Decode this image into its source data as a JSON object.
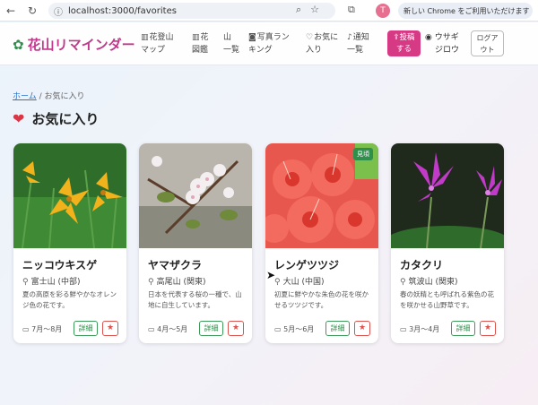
{
  "browser": {
    "url": "localhost:3000/favorites",
    "profile_initial": "T",
    "update_text": "新しい Chrome をご利用いただけます"
  },
  "header": {
    "logo": "花山リマインダー",
    "nav": [
      {
        "icon": "map-icon",
        "label1": "花登山",
        "label2": "マップ"
      },
      {
        "icon": "book-icon",
        "label1": "花",
        "label2": "図鑑"
      },
      {
        "icon": "",
        "label1": "山",
        "label2": "一覧"
      },
      {
        "icon": "camera-icon",
        "label1": "写真ラン",
        "label2": "キング"
      },
      {
        "icon": "heart-outline-icon",
        "label1": "お気に",
        "label2": "入り"
      },
      {
        "icon": "bell-icon",
        "label1": "通知",
        "label2": "一覧"
      }
    ],
    "post_label1": "投稿",
    "post_label2": "する",
    "user_label1": "ウサギ",
    "user_label2": "ジロウ",
    "logout_label1": "ログア",
    "logout_label2": "ウト"
  },
  "breadcrumb": {
    "home": "ホーム",
    "separator": "/",
    "current": "お気に入り"
  },
  "title": "お気に入り",
  "cards": [
    {
      "name": "ニッコウキスゲ",
      "location": "富士山 (中部)",
      "description": "夏の高原を彩る鮮やかなオレンジ色の花です。",
      "period": "7月〜8月",
      "detail": "詳細",
      "badge": ""
    },
    {
      "name": "ヤマザクラ",
      "location": "高尾山 (関東)",
      "description": "日本を代表する桜の一種で、山地に自生しています。",
      "period": "4月〜5月",
      "detail": "詳細",
      "badge": ""
    },
    {
      "name": "レンゲツツジ",
      "location": "大山 (中国)",
      "description": "初夏に鮮やかな朱色の花を咲かせるツツジです。",
      "period": "5月〜6月",
      "detail": "詳細",
      "badge": "見頃"
    },
    {
      "name": "カタクリ",
      "location": "筑波山 (関東)",
      "description": "春の妖精とも呼ばれる紫色の花を咲かせる山野草です。",
      "period": "3月〜4月",
      "detail": "詳細",
      "badge": ""
    }
  ]
}
